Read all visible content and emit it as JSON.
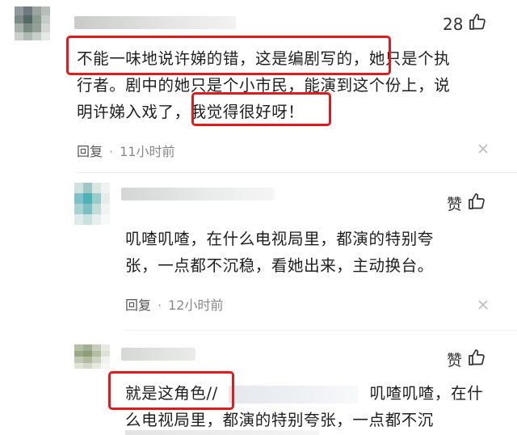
{
  "colors": {
    "highlight": "#e01b1b",
    "meta_text": "#555555",
    "time_text": "#888888"
  },
  "comment1": {
    "likes": "28",
    "line1_hl": "不能一味地说许娣的错，这是编剧写的，",
    "line1_rest": "她只是个执",
    "line2": "行者。剧中的她只是个小市民，能演到这个份上，说",
    "line3_pre": "明许娣入戏了，",
    "line3_hl": "我觉得很好呀！",
    "reply_label": "回复",
    "dot": "·",
    "time": "11小时前",
    "close_icon": "close-icon"
  },
  "reply1": {
    "like_label": "赞",
    "line1": "叽喳叽喳，在什么电视局里，都演的特别夸",
    "line2": "张，一点都不沉稳，看她出来，主动换台。",
    "reply_label": "回复",
    "dot": "·",
    "time": "12小时前"
  },
  "reply2": {
    "like_label": "赞",
    "line1_hl": "就是这角色//",
    "line1_rest": "叽喳叽喳，在什",
    "line2": "么电视局里，都演的特别夸张，一点都不沉"
  }
}
